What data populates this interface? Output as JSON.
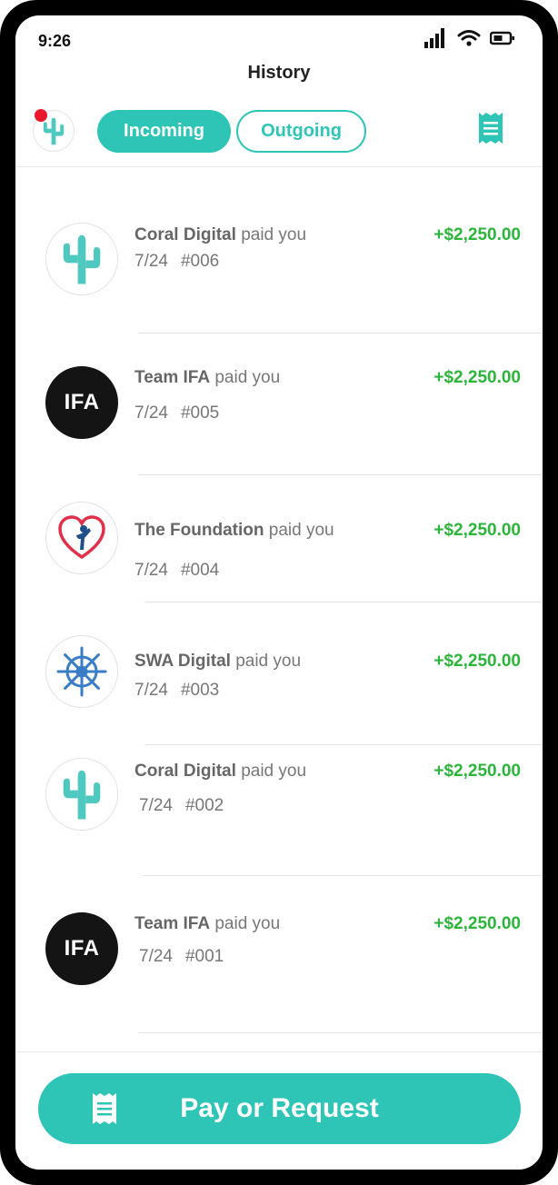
{
  "status_bar": {
    "time": "9:26"
  },
  "header": {
    "title": "History"
  },
  "tabs": [
    {
      "label": "Incoming",
      "active": true
    },
    {
      "label": "Outgoing",
      "active": false
    }
  ],
  "transactions": [
    {
      "payer": "Coral Digital",
      "action": "paid you",
      "date": "7/24",
      "number": "#006",
      "amount": "+$2,250.00",
      "logo": "cactus-icon"
    },
    {
      "payer": "Team IFA",
      "action": "paid you",
      "date": "7/24",
      "number": "#005",
      "amount": "+$2,250.00",
      "logo": "ifa-logo",
      "logo_text": "IFA"
    },
    {
      "payer": "The Foundation",
      "action": "paid you",
      "date": "7/24",
      "number": "#004",
      "amount": "+$2,250.00",
      "logo": "heart-person-icon"
    },
    {
      "payer": "SWA Digital",
      "action": "paid you",
      "date": "7/24",
      "number": "#003",
      "amount": "+$2,250.00",
      "logo": "ship-wheel-icon"
    },
    {
      "payer": "Coral Digital",
      "action": "paid you",
      "date": "7/24",
      "number": "#002",
      "amount": "+$2,250.00",
      "logo": "cactus-icon"
    },
    {
      "payer": "Team IFA",
      "action": "paid you",
      "date": "7/24",
      "number": "#001",
      "amount": "+$2,250.00",
      "logo": "ifa-logo",
      "logo_text": "IFA"
    }
  ],
  "footer": {
    "button_label": "Pay or Request"
  },
  "colors": {
    "accent": "#2ec4b6",
    "positive_amount": "#2bb53a",
    "notification": "#e8192c"
  }
}
